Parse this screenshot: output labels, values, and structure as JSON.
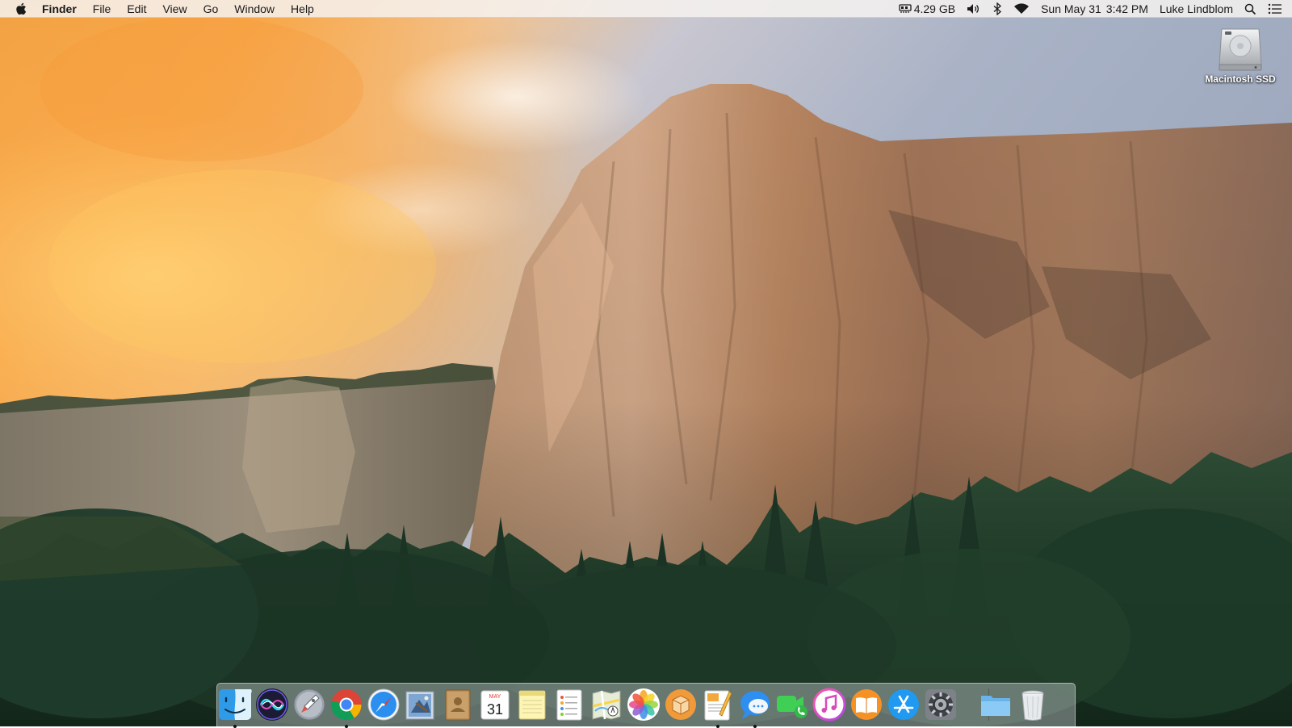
{
  "menubar": {
    "app_name": "Finder",
    "menus": [
      "File",
      "Edit",
      "View",
      "Go",
      "Window",
      "Help"
    ],
    "status": {
      "memory": "4.29 GB",
      "date": "Sun May 31",
      "time": "3:42 PM",
      "user": "Luke Lindblom"
    }
  },
  "desktop": {
    "icons": [
      {
        "label": "Macintosh SSD"
      }
    ]
  },
  "dock": {
    "apps": [
      {
        "name": "Finder",
        "icon": "finder-icon",
        "running": true
      },
      {
        "name": "Siri",
        "icon": "siri-icon",
        "running": false
      },
      {
        "name": "Launchpad",
        "icon": "launchpad-icon",
        "running": false
      },
      {
        "name": "Google Chrome",
        "icon": "chrome-icon",
        "running": true
      },
      {
        "name": "Safari",
        "icon": "safari-icon",
        "running": false
      },
      {
        "name": "Mail",
        "icon": "mail-icon",
        "running": false
      },
      {
        "name": "Contacts",
        "icon": "contacts-icon",
        "running": false
      },
      {
        "name": "Calendar",
        "icon": "calendar-icon",
        "running": false
      },
      {
        "name": "Notes",
        "icon": "notes-icon",
        "running": false
      },
      {
        "name": "Reminders",
        "icon": "reminders-icon",
        "running": false
      },
      {
        "name": "Maps",
        "icon": "maps-icon",
        "running": false
      },
      {
        "name": "Photos",
        "icon": "photos-icon",
        "running": false
      },
      {
        "name": "Archive Utility",
        "icon": "package-icon",
        "running": false
      },
      {
        "name": "Pages",
        "icon": "pages-icon",
        "running": true
      },
      {
        "name": "Messages",
        "icon": "messages-icon",
        "running": true
      },
      {
        "name": "FaceTime",
        "icon": "facetime-icon",
        "running": false
      },
      {
        "name": "iTunes",
        "icon": "itunes-icon",
        "running": false
      },
      {
        "name": "iBooks",
        "icon": "ibooks-icon",
        "running": false
      },
      {
        "name": "App Store",
        "icon": "app-store-icon",
        "running": false
      },
      {
        "name": "System Preferences",
        "icon": "system-preferences-icon",
        "running": false
      }
    ],
    "calendar": {
      "month": "MAY",
      "day": "31"
    },
    "stacks": [
      {
        "name": "Folder",
        "icon": "folder-icon"
      },
      {
        "name": "Trash",
        "icon": "trash-icon"
      }
    ]
  },
  "colors": {
    "menubar_bg": "#f6f2f0",
    "sky_orange": "#f5a240",
    "cliff": "#b98a67",
    "forest": "#1f3b2b"
  }
}
